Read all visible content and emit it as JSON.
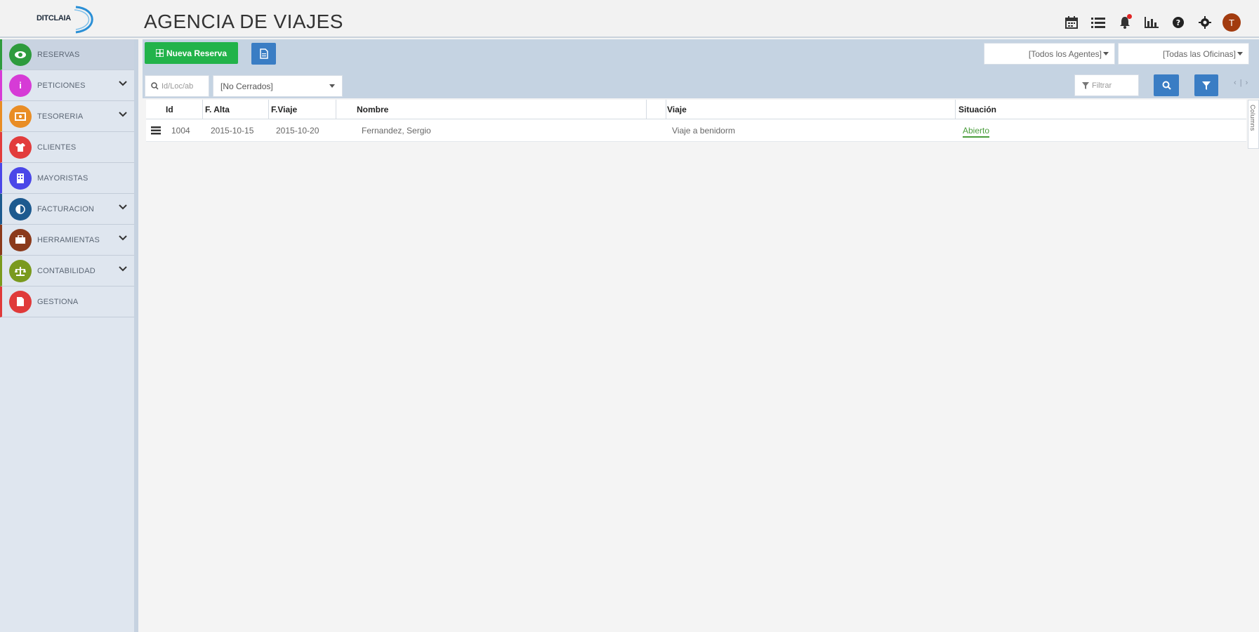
{
  "app": {
    "logo_text": "DITCLAIA",
    "title": "AGENCIA DE VIAJES",
    "avatar_initial": "T"
  },
  "header_icons": [
    "calendar-icon",
    "list-icon",
    "bell-icon",
    "chart-icon",
    "help-icon",
    "settings-icon"
  ],
  "sidebar": {
    "items": [
      {
        "label": "RESERVAS",
        "color": "#2e9b3d",
        "active": true
      },
      {
        "label": "PETICIONES",
        "color": "#d63bd6",
        "chevron": true
      },
      {
        "label": "TESORERIA",
        "color": "#e98d25",
        "chevron": true
      },
      {
        "label": "CLIENTES",
        "color": "#e23c3c"
      },
      {
        "label": "MAYORISTAS",
        "color": "#4a47e8"
      },
      {
        "label": "FACTURACION",
        "color": "#1d5a8f",
        "chevron": true
      },
      {
        "label": "HERRAMIENTAS",
        "color": "#8b3a1b",
        "chevron": true
      },
      {
        "label": "CONTABILIDAD",
        "color": "#7a9a1e",
        "chevron": true
      },
      {
        "label": "GESTIONA",
        "color": "#e03a3a"
      }
    ]
  },
  "toolbar": {
    "new_label": "Nueva Reserva",
    "agents_label": "[Todos los Agentes]",
    "offices_label": "[Todas las Oficinas]",
    "search_placeholder": "Id/Loc/ab",
    "status_value": "[No Cerrados]",
    "filter_placeholder": "Filtrar",
    "collapse_label": "‹ | ›"
  },
  "table": {
    "columns": [
      "Id",
      "F. Alta",
      "F.Viaje",
      "Nombre",
      "Viaje",
      "Situación"
    ],
    "rows": [
      {
        "id": "1004",
        "alta": "2015-10-15",
        "viaje_fecha": "2015-10-20",
        "nombre": "Fernandez, Sergio",
        "viaje": "Viaje a benidorm",
        "situacion": "Abierto"
      }
    ]
  },
  "columns_tab_label": "Columns",
  "colors": {
    "primary_blue": "#3a7dc4",
    "success_green": "#22b34a",
    "sidebar_bg": "#dfe6ef",
    "toolbar_bg": "#c5d3e2"
  }
}
